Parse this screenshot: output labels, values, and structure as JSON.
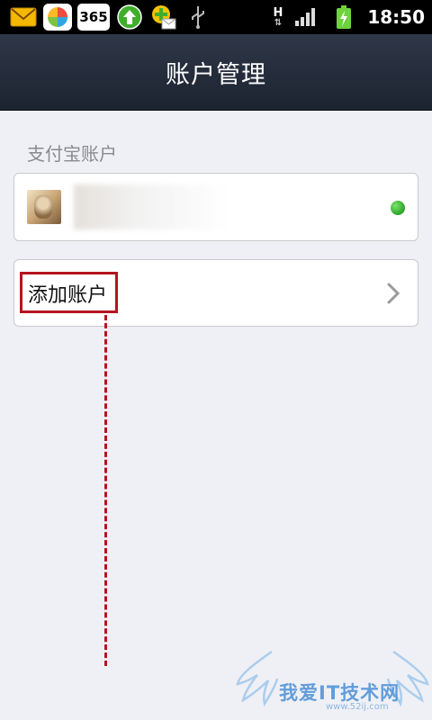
{
  "status_bar": {
    "time": "18:50",
    "app_badge": "365",
    "network_label": "H",
    "icons": [
      "mail-icon",
      "app-store-icon",
      "calendar-icon",
      "upload-icon",
      "mail-notification-icon",
      "usb-icon",
      "network-h-icon",
      "signal-icon",
      "battery-charging-icon"
    ]
  },
  "header": {
    "title": "账户管理"
  },
  "section": {
    "label": "支付宝账户"
  },
  "account": {
    "name": "",
    "status_color": "#2aa42a"
  },
  "add_account": {
    "label": "添加账户"
  },
  "watermark": {
    "text": "我爱IT技术网",
    "url": "www.52ij.com"
  },
  "colors": {
    "accent_annotation": "#b5141f",
    "header_bg": "#252d3b",
    "page_bg": "#eff0f5"
  }
}
